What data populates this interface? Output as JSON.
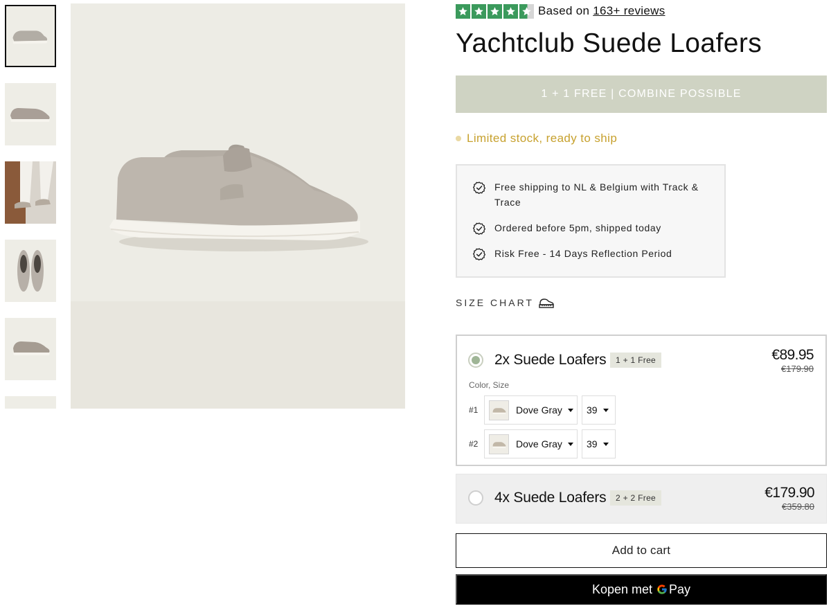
{
  "rating": {
    "stars": 4.5,
    "star_color": "#3b9a5c",
    "prefix": "Based on",
    "link": "163+ reviews"
  },
  "product": {
    "title": "Yachtclub Suede Loafers"
  },
  "promo": {
    "text": "1 + 1 FREE | COMBINE POSSIBLE",
    "color": "#cfd3c3"
  },
  "stock": {
    "text": "Limited stock, ready to ship",
    "color": "#c7a12e"
  },
  "usps": [
    {
      "icon": "badge-check-icon",
      "text": "Free shipping to NL & Belgium with Track & Trace"
    },
    {
      "icon": "badge-check-icon",
      "text": "Ordered before 5pm, shipped today"
    },
    {
      "icon": "badge-check-icon",
      "text": "Risk Free - 14 Days Reflection Period"
    }
  ],
  "size_chart": {
    "label": "SIZE CHART",
    "icon": "ruler-shoe-icon"
  },
  "bundles": [
    {
      "name": "2x Suede Loafers",
      "badge": "1 + 1 Free",
      "price": "€89.95",
      "old_price": "€179.90",
      "selected": true,
      "options_label": "Color, Size",
      "options": [
        {
          "index": "#1",
          "color": "Dove Gray",
          "size": "39"
        },
        {
          "index": "#2",
          "color": "Dove Gray",
          "size": "39"
        }
      ]
    },
    {
      "name": "4x Suede Loafers",
      "badge": "2 + 2 Free",
      "price": "€179.90",
      "old_price": "€359.80",
      "selected": false
    }
  ],
  "buttons": {
    "add_to_cart": "Add to cart",
    "gpay_prefix": "Kopen met",
    "gpay_suffix": "Pay"
  }
}
